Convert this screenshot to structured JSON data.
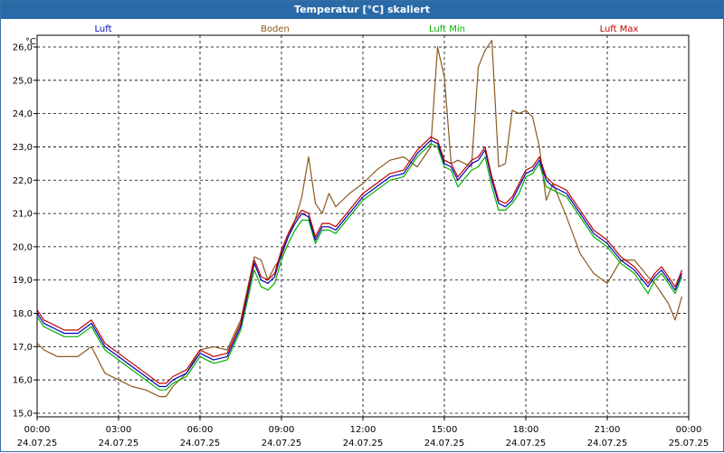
{
  "window": {
    "title": "Temperatur [°C] skaliert"
  },
  "chart_data": {
    "type": "line",
    "title": "Temperatur [°C] skaliert",
    "yunit": "°C",
    "ylim": [
      15.0,
      26.0
    ],
    "yticks": [
      "15,0",
      "16,0",
      "17,0",
      "18,0",
      "19,0",
      "20,0",
      "21,0",
      "22,0",
      "23,0",
      "24,0",
      "25,0",
      "26,0"
    ],
    "xtick_times": [
      "00:00",
      "03:00",
      "06:00",
      "09:00",
      "12:00",
      "15:00",
      "18:00",
      "21:00",
      "00:00"
    ],
    "xtick_dates": [
      "24.07.25",
      "24.07.25",
      "24.07.25",
      "24.07.25",
      "24.07.25",
      "24.07.25",
      "24.07.25",
      "24.07.25",
      "25.07.25"
    ],
    "grid": true,
    "legend_position": "top",
    "x_hours": [
      0,
      0.25,
      0.5,
      0.75,
      1,
      1.5,
      2,
      2.5,
      3,
      3.5,
      4,
      4.5,
      4.75,
      5,
      5.5,
      6,
      6.5,
      7,
      7.5,
      8,
      8.25,
      8.5,
      8.75,
      9,
      9.25,
      9.5,
      9.75,
      10,
      10.25,
      10.5,
      10.75,
      11,
      11.5,
      12,
      12.5,
      13,
      13.5,
      14,
      14.5,
      14.75,
      15,
      15.25,
      15.5,
      16,
      16.25,
      16.5,
      16.75,
      17,
      17.25,
      17.5,
      17.75,
      18,
      18.25,
      18.5,
      18.75,
      19,
      19.5,
      20,
      20.5,
      21,
      21.5,
      22,
      22.5,
      22.75,
      23,
      23.25,
      23.5,
      23.75
    ],
    "series": [
      {
        "name": "Luft",
        "color": "#0000c0",
        "values": [
          18.0,
          17.7,
          17.6,
          17.5,
          17.4,
          17.4,
          17.7,
          17.0,
          16.7,
          16.4,
          16.1,
          15.8,
          15.8,
          16.0,
          16.2,
          16.8,
          16.6,
          16.7,
          17.6,
          19.5,
          19.0,
          18.9,
          19.1,
          19.8,
          20.3,
          20.7,
          21.0,
          20.9,
          20.2,
          20.6,
          20.6,
          20.5,
          21.0,
          21.5,
          21.8,
          22.1,
          22.2,
          22.8,
          23.2,
          23.1,
          22.5,
          22.4,
          22.0,
          22.5,
          22.6,
          22.9,
          22.0,
          21.3,
          21.2,
          21.4,
          21.8,
          22.2,
          22.3,
          22.6,
          22.0,
          21.8,
          21.6,
          21.0,
          20.4,
          20.1,
          19.6,
          19.3,
          18.8,
          19.1,
          19.3,
          19.0,
          18.7,
          19.2
        ]
      },
      {
        "name": "Boden",
        "color": "#8b5a1e",
        "values": [
          17.1,
          16.9,
          16.8,
          16.7,
          16.7,
          16.7,
          17.0,
          16.2,
          16.0,
          15.8,
          15.7,
          15.5,
          15.5,
          15.8,
          16.2,
          16.9,
          17.0,
          16.9,
          17.8,
          19.7,
          19.6,
          19.0,
          19.4,
          19.7,
          20.3,
          20.8,
          21.5,
          22.7,
          21.3,
          21.0,
          21.6,
          21.2,
          21.6,
          21.9,
          22.3,
          22.6,
          22.7,
          22.4,
          23.0,
          26.0,
          25.1,
          22.5,
          22.6,
          22.4,
          25.4,
          25.9,
          26.2,
          22.4,
          22.5,
          24.1,
          24.0,
          24.1,
          23.9,
          23.0,
          21.4,
          21.9,
          20.9,
          19.8,
          19.2,
          18.9,
          19.6,
          19.6,
          19.1,
          18.9,
          18.6,
          18.3,
          17.8,
          18.5
        ]
      },
      {
        "name": "Luft Min",
        "color": "#00b000",
        "values": [
          17.9,
          17.6,
          17.5,
          17.4,
          17.3,
          17.3,
          17.6,
          16.9,
          16.6,
          16.3,
          16.0,
          15.7,
          15.7,
          15.9,
          16.1,
          16.7,
          16.5,
          16.6,
          17.5,
          19.3,
          18.8,
          18.7,
          18.9,
          19.6,
          20.1,
          20.5,
          20.8,
          20.8,
          20.1,
          20.5,
          20.5,
          20.4,
          20.9,
          21.4,
          21.7,
          22.0,
          22.1,
          22.7,
          23.1,
          23.0,
          22.4,
          22.3,
          21.8,
          22.3,
          22.4,
          22.7,
          21.8,
          21.1,
          21.1,
          21.3,
          21.6,
          22.1,
          22.2,
          22.5,
          21.8,
          21.7,
          21.5,
          20.9,
          20.3,
          20.0,
          19.5,
          19.2,
          18.6,
          19.0,
          19.2,
          18.9,
          18.6,
          19.1
        ]
      },
      {
        "name": "Luft Max",
        "color": "#c00000",
        "values": [
          18.1,
          17.8,
          17.7,
          17.6,
          17.5,
          17.5,
          17.8,
          17.1,
          16.8,
          16.5,
          16.2,
          15.9,
          15.9,
          16.1,
          16.3,
          16.9,
          16.7,
          16.8,
          17.7,
          19.6,
          19.1,
          19.0,
          19.2,
          19.9,
          20.4,
          20.8,
          21.1,
          21.0,
          20.3,
          20.7,
          20.7,
          20.6,
          21.1,
          21.6,
          21.9,
          22.2,
          22.3,
          22.9,
          23.3,
          23.2,
          22.6,
          22.5,
          22.1,
          22.6,
          22.7,
          23.0,
          22.1,
          21.4,
          21.3,
          21.5,
          21.9,
          22.3,
          22.4,
          22.7,
          22.1,
          21.9,
          21.7,
          21.1,
          20.5,
          20.2,
          19.7,
          19.4,
          18.9,
          19.2,
          19.4,
          19.1,
          18.8,
          19.3
        ]
      }
    ]
  }
}
